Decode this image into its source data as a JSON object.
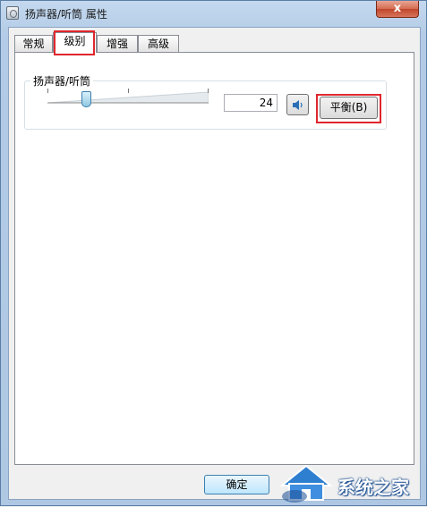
{
  "window": {
    "title": "扬声器/听筒 属性",
    "close_label": "x"
  },
  "tabs": [
    {
      "label": "常规",
      "active": false
    },
    {
      "label": "级别",
      "active": true
    },
    {
      "label": "增强",
      "active": false
    },
    {
      "label": "高级",
      "active": false
    }
  ],
  "level_group": {
    "label": "扬声器/听筒",
    "level_value": "24",
    "slider_fraction": 0.24,
    "mute_icon": "speaker-icon",
    "balance_label": "平衡(B)"
  },
  "footer": {
    "ok_label": "确定"
  },
  "watermark": {
    "text": "系统之家"
  },
  "colors": {
    "highlight": "#e0262d",
    "accent": "#3c7fb1"
  }
}
